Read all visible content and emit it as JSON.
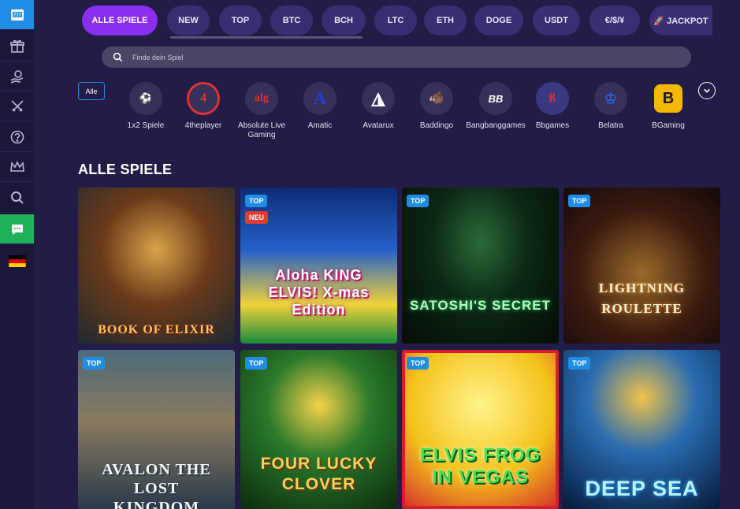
{
  "sidebar": {
    "items": [
      {
        "icon": "slot-machine-icon"
      },
      {
        "icon": "gift-icon"
      },
      {
        "icon": "money-hand-icon"
      },
      {
        "icon": "crossed-swords-icon"
      },
      {
        "icon": "help-icon"
      },
      {
        "icon": "crown-icon"
      },
      {
        "icon": "search-icon"
      },
      {
        "icon": "chat-icon"
      },
      {
        "icon": "german-flag-icon"
      }
    ],
    "colors": {
      "active": "#1f8de6",
      "chat": "#21b15b"
    }
  },
  "tabs": [
    {
      "label": "ALLE SPIELE",
      "active": true
    },
    {
      "label": "NEW"
    },
    {
      "label": "TOP"
    },
    {
      "label": "BTC"
    },
    {
      "label": "BCH"
    },
    {
      "label": "LTC"
    },
    {
      "label": "ETH"
    },
    {
      "label": "DOGE"
    },
    {
      "label": "USDT"
    },
    {
      "label": "€/$/¥"
    },
    {
      "label": "🚀 JACKPOT"
    }
  ],
  "search": {
    "placeholder": "Finde dein Spiel"
  },
  "providers": {
    "all_label": "Alle",
    "items": [
      {
        "name": "1x2 Spiele",
        "logo": "⚽"
      },
      {
        "name": "4theplayer",
        "logo": "4"
      },
      {
        "name": "Absolute Live Gaming",
        "logo": "alg"
      },
      {
        "name": "Amatic",
        "logo": "A"
      },
      {
        "name": "Avatarux",
        "logo": "◮"
      },
      {
        "name": "Baddingo",
        "logo": "🐗"
      },
      {
        "name": "Bangbanggames",
        "logo": "BB"
      },
      {
        "name": "Bbgames",
        "logo": "ß"
      },
      {
        "name": "Belatra",
        "logo": "♔"
      },
      {
        "name": "BGaming",
        "logo": "B"
      }
    ]
  },
  "section_title": "ALLE SPIELE",
  "games": [
    {
      "title": "BOOK OF ELIXIR",
      "badges": []
    },
    {
      "title": "Aloha KING ELVIS! X-mas Edition",
      "badges": [
        "TOP",
        "NEU"
      ]
    },
    {
      "title": "SATOSHI'S SECRET",
      "badges": [
        "TOP"
      ]
    },
    {
      "title": "LIGHTNING ROULETTE",
      "badges": [
        "TOP"
      ]
    },
    {
      "title": "AVALON THE LOST KINGDOM",
      "badges": [
        "TOP"
      ]
    },
    {
      "title": "FOUR LUCKY CLOVER",
      "badges": [
        "TOP"
      ]
    },
    {
      "title": "ELVIS FROG IN VEGAS",
      "badges": [
        "TOP"
      ]
    },
    {
      "title": "DEEP SEA",
      "badges": [
        "TOP"
      ]
    }
  ]
}
